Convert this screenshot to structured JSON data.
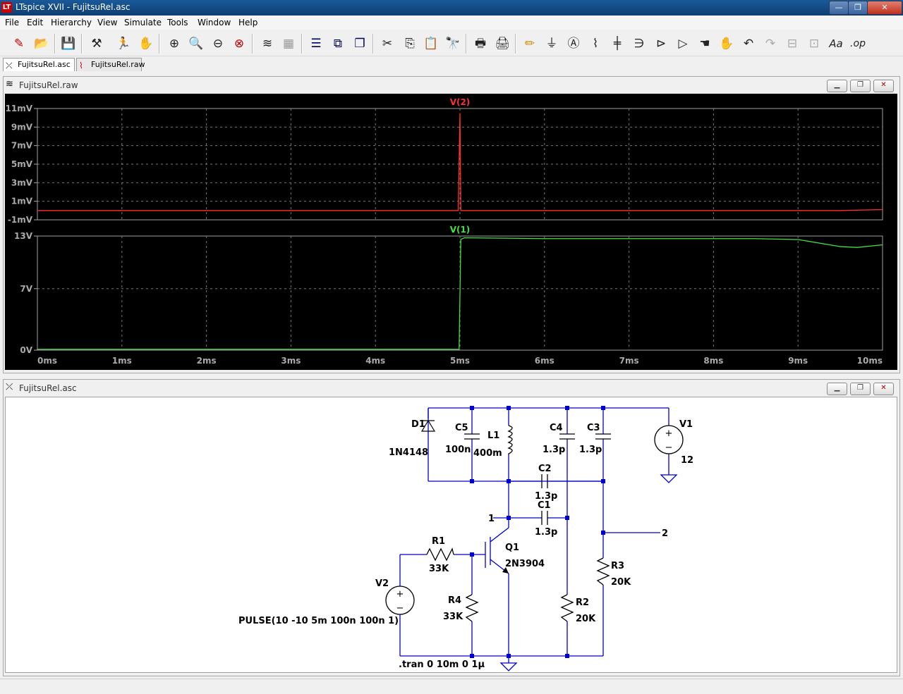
{
  "window": {
    "title": "LTspice XVII - FujitsuRel.asc",
    "min": "—",
    "max": "❐",
    "close": "✕"
  },
  "menu": [
    "File",
    "Edit",
    "Hierarchy",
    "View",
    "Simulate",
    "Tools",
    "Window",
    "Help"
  ],
  "tabs": [
    {
      "label": "FujitsuRel.asc",
      "active": true
    },
    {
      "label": "FujitsuRel.raw",
      "active": false
    }
  ],
  "waveform": {
    "title": "FujitsuRel.raw",
    "top": {
      "label": "V(2)",
      "color": "#ff3030",
      "yticks": [
        "11mV",
        "9mV",
        "7mV",
        "5mV",
        "3mV",
        "1mV",
        "-1mV"
      ]
    },
    "bottom": {
      "label": "V(1)",
      "color": "#40e040",
      "yticks": [
        "13V",
        "7V",
        "0V"
      ]
    },
    "xticks": [
      "0ms",
      "1ms",
      "2ms",
      "3ms",
      "4ms",
      "5ms",
      "6ms",
      "7ms",
      "8ms",
      "9ms",
      "10ms"
    ]
  },
  "chart_data": [
    {
      "type": "line",
      "title": "V(2)",
      "x": [
        0,
        4.98,
        5.0,
        5.01,
        5.03,
        9.5,
        10
      ],
      "values": [
        0,
        0,
        10.5,
        0,
        0,
        0,
        0.1
      ],
      "ylim": [
        -1,
        11
      ],
      "xlim": [
        0,
        10
      ],
      "grid": true
    },
    {
      "type": "line",
      "title": "V(1)",
      "x": [
        0,
        4.99,
        5.01,
        5.05,
        6.0,
        8.5,
        9.0,
        9.5,
        9.7,
        10
      ],
      "values": [
        0.1,
        0.1,
        12.6,
        12.8,
        12.7,
        12.7,
        12.6,
        11.8,
        11.7,
        12.0
      ],
      "ylim": [
        0,
        13
      ],
      "xlim": [
        0,
        10
      ],
      "grid": true
    }
  ],
  "schematic": {
    "title": "FujitsuRel.asc",
    "labels": {
      "d1": "D1",
      "d1v": "1N4148",
      "c5": "C5",
      "c5v": "100n",
      "l1": "L1",
      "l1v": "400m",
      "c4": "C4",
      "c4v": "1.3p",
      "c3": "C3",
      "c3v": "1.3p",
      "v1": "V1",
      "v1v": "12",
      "c2": "C2",
      "c2v": "1.3p",
      "c1": "C1",
      "c1v": "1.3p",
      "n1": "1",
      "n2": "2",
      "r1": "R1",
      "r1v": "33K",
      "q1": "Q1",
      "q1v": "2N3904",
      "v2": "V2",
      "v2v": "PULSE(10 -10 5m 100n 100n 1)",
      "r4": "R4",
      "r4v": "33K",
      "r2": "R2",
      "r2v": "20K",
      "r3": "R3",
      "r3v": "20K",
      "tran": ".tran 0 10m 0 1µ"
    }
  }
}
